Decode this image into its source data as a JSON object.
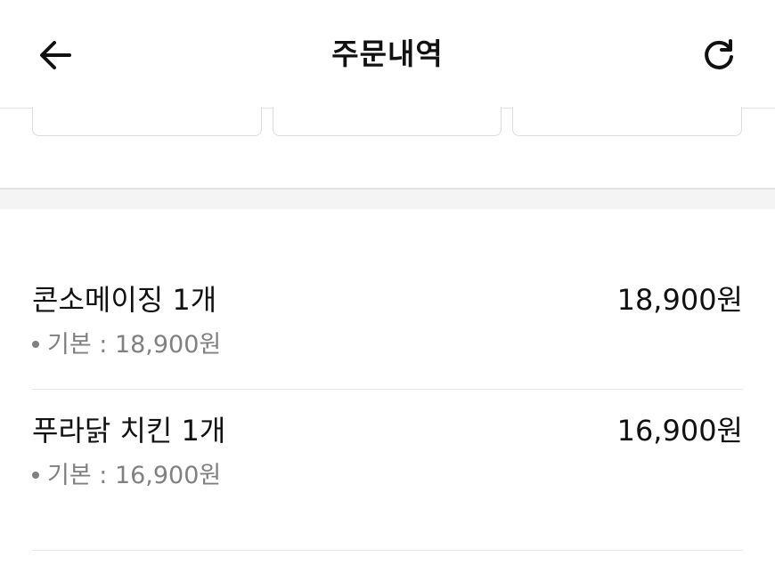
{
  "header": {
    "title": "주문내역",
    "back_icon": "arrow-left-icon",
    "refresh_icon": "refresh-icon"
  },
  "order_items": [
    {
      "name": "콘소메이징 1개",
      "price": "18,900원",
      "option": "기본 : 18,900원"
    },
    {
      "name": "푸라닭 치킨 1개",
      "price": "16,900원",
      "option": "기본 : 16,900원"
    }
  ],
  "colors": {
    "text_primary": "#111111",
    "text_secondary": "#808080",
    "divider": "#e8e8e8",
    "section_gap": "#f4f4f4"
  }
}
